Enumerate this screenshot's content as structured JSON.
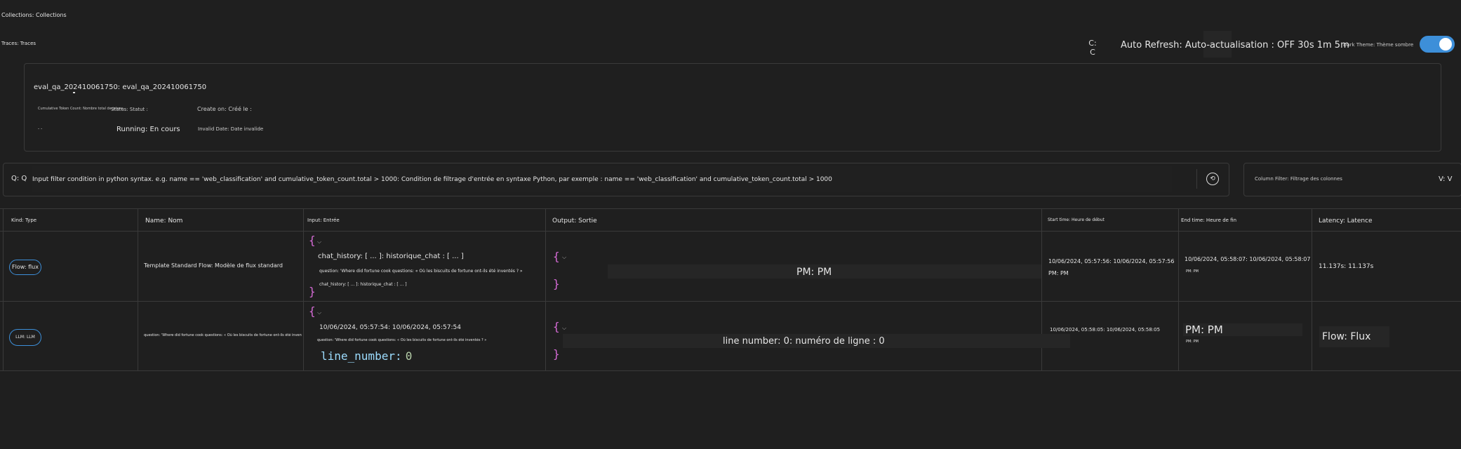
{
  "header": {
    "collections_label": "Collections: Collections",
    "traces_label": "Traces: Traces",
    "refresh_icon_glyph": "C: C",
    "auto_refresh_label": "Auto Refresh: Auto-actualisation : OFF 30s 1m 5m",
    "dark_theme_label": "Dark Theme: Thème sombre",
    "dark_theme_on": true,
    "accent_color": "#3d8fd9"
  },
  "summary": {
    "run_name": "eval_qa_202410061750: eval_qa_202410061750",
    "token_label": "Cumulative Token Count: Nombre total de jetons",
    "status_label": "Status: Statut :",
    "created_label": "Create on: Créé le :",
    "token_value": "- -",
    "status_value": "Running: En cours",
    "created_value": "Invalid Date: Date invalide"
  },
  "filter": {
    "q_label": "Q: Q",
    "placeholder": "Input filter condition in python syntax. e.g. name == 'web_classification' and cumulative_token_count.total > 1000: Condition de filtrage d'entrée en syntaxe Python, par exemple : name == 'web_classification' and cumulative_token_count.total > 1000",
    "history_icon": "⟲",
    "column_filter_label": "Column Filter: Filtrage des colonnes",
    "column_filter_v": "V: V"
  },
  "table": {
    "headers": {
      "kind": "Kind: Type",
      "name": "Name: Nom",
      "input": "Input: Entrée",
      "output": "Output: Sortie",
      "start": "Start time: Heure de début",
      "end": "End time: Heure de fin",
      "latency": "Latency: Latence"
    },
    "rows": [
      {
        "kind": "Flow: flux",
        "name": "Template Standard Flow: Modèle de flux standard",
        "input_line1": "chat_history: [ ... ]: historique_chat : [ ... ]",
        "input_line2": "question: 'Where did fortune cook questions: « Où les biscuits de fortune ont-ils été inventés ? »",
        "input_line3": "chat_history: [ ... ]: historique_chat : [ ... ]",
        "output_text": "PM: PM",
        "start": "10/06/2024, 05:57:56: 10/06/2024, 05:57:56 PM: PM",
        "end": "10/06/2024, 05:58:07: 10/06/2024, 05:58:07",
        "end_suffix": "PM: PM",
        "latency": "11.137s: 11.137s"
      },
      {
        "kind": "LLM: LLM",
        "name": "question: 'Where did fortune cook questions: « Où les biscuits de fortune ont-ils été inventés ? »",
        "input_line1": "10/06/2024, 05:57:54: 10/06/2024, 05:57:54",
        "input_line2": "question: 'Where did fortune cook questions: « Où les biscuits de fortune ont-ils été inventés ? »",
        "input_key": "line_number",
        "input_val": "0",
        "output_text": "line number: 0: numéro de ligne : 0",
        "start": "10/06/2024, 05:58:05: 10/06/2024, 05:58:05",
        "end": "PM: PM",
        "end_suffix": "PM: PM",
        "latency": "Flow: Flux"
      }
    ]
  }
}
